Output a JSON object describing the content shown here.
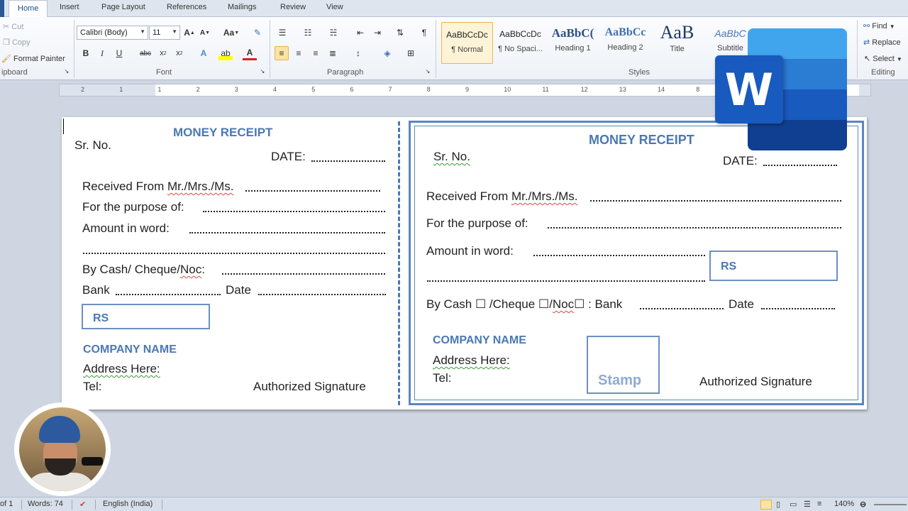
{
  "tabs": [
    "Home",
    "Insert",
    "Page Layout",
    "References",
    "Mailings",
    "Review",
    "View"
  ],
  "clipboard": {
    "cut": "Cut",
    "copy": "Copy",
    "format_painter": "Format Painter",
    "label": "ipboard"
  },
  "font": {
    "name": "Calibri (Body)",
    "size": "11",
    "label": "Font",
    "change_case": "Aa"
  },
  "paragraph": {
    "label": "Paragraph"
  },
  "styles": {
    "label": "Styles",
    "items": [
      {
        "sample": "AaBbCcDc",
        "name": "¶ Normal"
      },
      {
        "sample": "AaBbCcDc",
        "name": "¶ No Spaci..."
      },
      {
        "sample": "AaBbC(",
        "name": "Heading 1"
      },
      {
        "sample": "AaBbCc",
        "name": "Heading 2"
      },
      {
        "sample": "AaB",
        "name": "Title"
      },
      {
        "sample": "AaBbC",
        "name": "Subtitle"
      }
    ]
  },
  "editing": {
    "find": "Find",
    "replace": "Replace",
    "select": "Select",
    "label": "Editing"
  },
  "ruler": {
    "marks": [
      "2",
      "1",
      "1",
      "2",
      "3",
      "4",
      "5",
      "6",
      "7",
      "8",
      "9",
      "10",
      "11",
      "12",
      "13",
      "14",
      "8"
    ]
  },
  "receipt_left": {
    "title": "MONEY RECEIPT",
    "sr_no": "Sr. No.",
    "date": "DATE:",
    "received_prefix": "Received From ",
    "received_name": "Mr./Mrs./Ms.",
    "purpose": "For the purpose of:",
    "amount": "Amount in word:",
    "by_cash": "By Cash/ Cheque/",
    "noc": "Noc",
    "bank": "Bank",
    "date2": "Date",
    "rs": "RS",
    "company": "COMPANY NAME",
    "address": "Address  Here:",
    "tel": "Tel:",
    "signature": "Authorized Signature"
  },
  "receipt_right": {
    "title": "MONEY RECEIPT",
    "sr_no": "Sr. No.",
    "date": "DATE:",
    "received_prefix": "Received From ",
    "received_name": "Mr./Mrs./Ms.",
    "purpose": "For the purpose of:",
    "amount": "Amount in word:",
    "rs": "RS",
    "by_cash": "By Cash ☐ /Cheque ☐/",
    "noc": "Noc",
    "bank_part": "☐ : Bank",
    "date2": "Date",
    "company": "COMPANY NAME",
    "address": "Address  Here:",
    "tel": "Tel:",
    "stamp": "Stamp",
    "signature": "Authorized Signature"
  },
  "status": {
    "page": "of 1",
    "words": "Words: 74",
    "language": "English (India)",
    "zoom": "140%"
  },
  "logo": {
    "letter": "W"
  }
}
